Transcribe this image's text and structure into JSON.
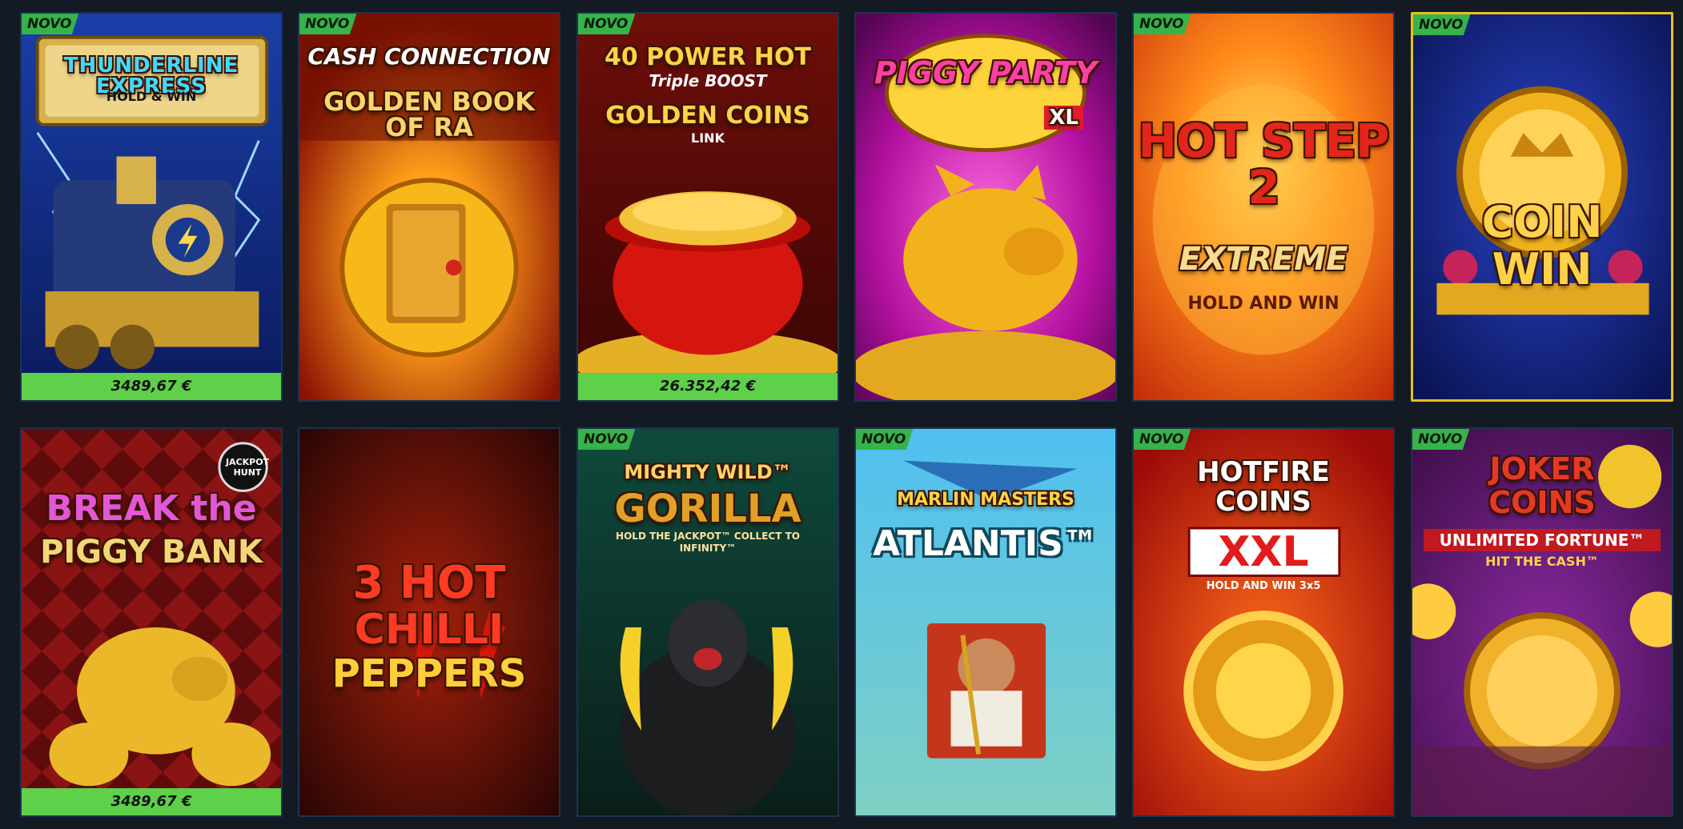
{
  "badge_label": "NOVO",
  "colors": {
    "background": "#131a23",
    "badge": "#36b34a",
    "jackpot_bar": "#5ed04a",
    "selected_border": "#e8c01e"
  },
  "games": [
    {
      "title": "THUNDERLINE EXPRESS",
      "subtitle": "HOLD & WIN",
      "badge": true,
      "jackpot": "3489,67 €",
      "icon": "train-icon"
    },
    {
      "title_top": "CASH CONNECTION",
      "title": "GOLDEN BOOK OF RA",
      "badge": true,
      "icon": "golden-book-icon"
    },
    {
      "title_top": "40 POWER HOT",
      "title_mid": "Triple BOOST",
      "title": "GOLDEN COINS",
      "subtitle": "LINK",
      "badge": true,
      "jackpot": "26.352,42 €",
      "icon": "pot-of-gold-icon"
    },
    {
      "title": "PIGGY PARTY",
      "subtitle": "XL",
      "badge": false,
      "icon": "gold-piggy-icon"
    },
    {
      "title": "HOT STEP 2",
      "title_mid": "EXTREME",
      "subtitle": "HOLD AND WIN",
      "badge": true,
      "icon": "flame-burst-icon"
    },
    {
      "title": "COIN WIN",
      "badge": true,
      "selected": true,
      "icon": "crown-coin-icon"
    },
    {
      "title_top": "BREAK the",
      "title": "PIGGY BANK",
      "corner_logo": "JACKPOT HUNT",
      "badge": false,
      "jackpot": "3489,67 €",
      "icon": "gold-piggy-bank-icon"
    },
    {
      "title_top": "3 HOT",
      "title_mid": "CHILLI",
      "title": "PEPPERS",
      "badge": false,
      "icon": "chilli-pepper-icon"
    },
    {
      "title_top": "MIGHTY WILD™",
      "title": "GORILLA",
      "subtitle": "HOLD THE JACKPOT™ COLLECT TO INFINITY™",
      "badge": true,
      "icon": "gorilla-icon"
    },
    {
      "title_top": "MARLIN MASTERS",
      "title": "ATLANTIS™",
      "badge": true,
      "icon": "poseidon-icon"
    },
    {
      "title_top": "HOTFIRE COINS",
      "title": "XXL",
      "subtitle": "HOLD AND WIN 3x5",
      "badge": true,
      "icon": "fire-coin-icon"
    },
    {
      "title_top": "JOKER COINS",
      "title": "UNLIMITED FORTUNE™",
      "subtitle": "HIT THE CASH™",
      "badge": true,
      "icon": "joker-coin-icon"
    }
  ]
}
